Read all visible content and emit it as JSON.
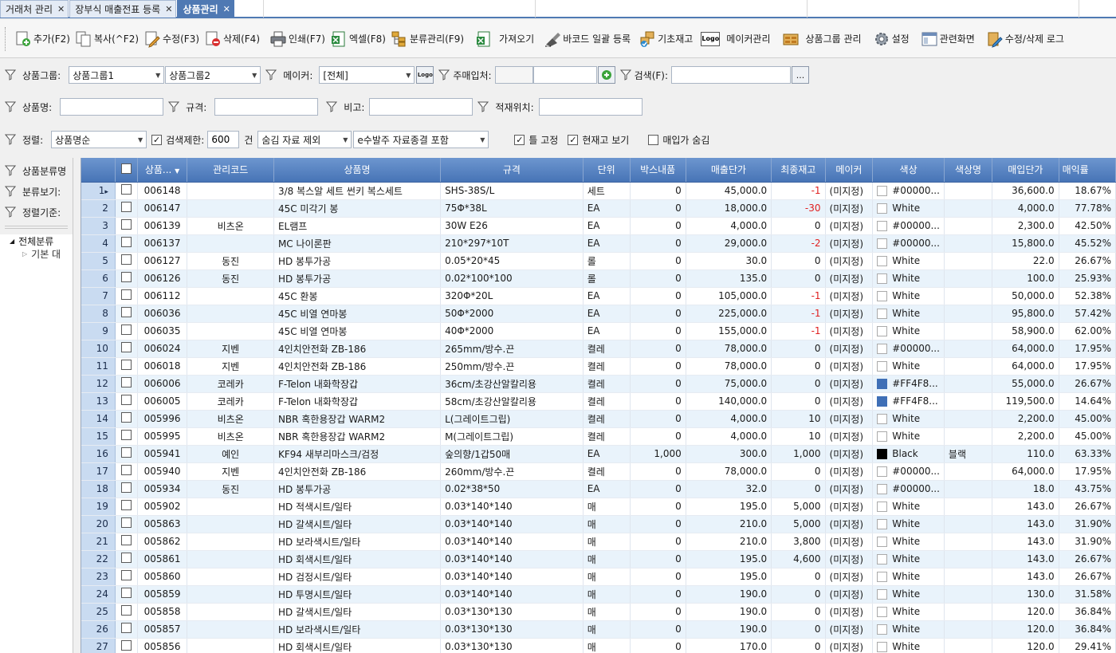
{
  "tabs": [
    {
      "label": "거래처 관리"
    },
    {
      "label": "장부식 매출전표 등록"
    },
    {
      "label": "상품관리"
    }
  ],
  "toolbar": {
    "add": "추가(F2)",
    "copy": "복사(^F2)",
    "edit": "수정(F3)",
    "delete": "삭제(F4)",
    "print": "인쇄(F7)",
    "excel": "엑셀(F8)",
    "category": "분류관리(F9)",
    "import": "가져오기",
    "barcode": "바코드 일괄 등록",
    "base_stock": "기초재고",
    "logo_badge": "Logo",
    "maker": "메이커관리",
    "product_group": "상품그룹 관리",
    "settings": "설정",
    "related": "관련화면",
    "log": "수정/삭제 로그"
  },
  "filters": {
    "group_label": "상품그룹:",
    "group1": "상품그룹1",
    "group2": "상품그룹2",
    "maker_label": "메이커:",
    "maker_value": "[전체]",
    "maker_logo": "Logo",
    "supplier_label": "주매입처:",
    "search_label": "검색(F):",
    "more": "...",
    "name_label": "상품명:",
    "spec_label": "규격:",
    "note_label": "비고:",
    "location_label": "적재위치:",
    "sort_label": "정렬:",
    "sort_value": "상품명순",
    "limit_label": "검색제한:",
    "limit_value": "600",
    "limit_unit": "건",
    "hidden_option": "숨김 자료 제외",
    "order_option": "e수발주 자료종결 포함",
    "fix_frame": "틀 고정",
    "show_stock": "현재고 보기",
    "hide_cost": "매입가 숨김"
  },
  "left_panel": {
    "category_view": "상품분류명",
    "browse": "분류보기:",
    "sort_basis": "정렬기준:",
    "tree_root": "전체분류",
    "tree_child": "기본 대"
  },
  "grid": {
    "columns": [
      "상품...",
      "관리코드",
      "상품명",
      "규격",
      "단위",
      "박스내품",
      "매출단가",
      "최종재고",
      "메이커",
      "색상",
      "색상명",
      "매입단가",
      "매익률"
    ],
    "rows": [
      {
        "n": "1",
        "code": "006148",
        "mgmt": "",
        "name": "3/8 복스알 세트 썬키 복스세트",
        "spec": "SHS-38S/L",
        "unit": "세트",
        "box": "0",
        "price": "45,000.0",
        "stock": "-1",
        "maker": "(미지정)",
        "color": "#00000...",
        "colorname": "",
        "cost": "36,600.0",
        "margin": "18.67%",
        "swatch": "#ffffff",
        "neg": true
      },
      {
        "n": "2",
        "code": "006147",
        "mgmt": "",
        "name": "45C 미각기 봉",
        "spec": "75Φ*38L",
        "unit": "EA",
        "box": "0",
        "price": "18,000.0",
        "stock": "-30",
        "maker": "(미지정)",
        "color": "White",
        "colorname": "",
        "cost": "4,000.0",
        "margin": "77.78%",
        "swatch": "#ffffff",
        "neg": true
      },
      {
        "n": "3",
        "code": "006139",
        "mgmt": "비츠온",
        "name": "EL램프",
        "spec": "30W E26",
        "unit": "EA",
        "box": "0",
        "price": "4,000.0",
        "stock": "0",
        "maker": "(미지정)",
        "color": "#00000...",
        "colorname": "",
        "cost": "2,300.0",
        "margin": "42.50%",
        "swatch": "#ffffff",
        "neg": false
      },
      {
        "n": "4",
        "code": "006137",
        "mgmt": "",
        "name": "MC 나이론판",
        "spec": "210*297*10T",
        "unit": "EA",
        "box": "0",
        "price": "29,000.0",
        "stock": "-2",
        "maker": "(미지정)",
        "color": "#00000...",
        "colorname": "",
        "cost": "15,800.0",
        "margin": "45.52%",
        "swatch": "#ffffff",
        "neg": true
      },
      {
        "n": "5",
        "code": "006127",
        "mgmt": "동진",
        "name": "HD 봉투가공",
        "spec": "0.05*20*45",
        "unit": "롤",
        "box": "0",
        "price": "30.0",
        "stock": "0",
        "maker": "(미지정)",
        "color": "White",
        "colorname": "",
        "cost": "22.0",
        "margin": "26.67%",
        "swatch": "#ffffff",
        "neg": false
      },
      {
        "n": "6",
        "code": "006126",
        "mgmt": "동진",
        "name": "HD 봉투가공",
        "spec": "0.02*100*100",
        "unit": "롤",
        "box": "0",
        "price": "135.0",
        "stock": "0",
        "maker": "(미지정)",
        "color": "White",
        "colorname": "",
        "cost": "100.0",
        "margin": "25.93%",
        "swatch": "#ffffff",
        "neg": false
      },
      {
        "n": "7",
        "code": "006112",
        "mgmt": "",
        "name": "45C 환봉",
        "spec": "320Φ*20L",
        "unit": "EA",
        "box": "0",
        "price": "105,000.0",
        "stock": "-1",
        "maker": "(미지정)",
        "color": "White",
        "colorname": "",
        "cost": "50,000.0",
        "margin": "52.38%",
        "swatch": "#ffffff",
        "neg": true
      },
      {
        "n": "8",
        "code": "006036",
        "mgmt": "",
        "name": "45C 비열 연마봉",
        "spec": "50Φ*2000",
        "unit": "EA",
        "box": "0",
        "price": "225,000.0",
        "stock": "-1",
        "maker": "(미지정)",
        "color": "White",
        "colorname": "",
        "cost": "95,800.0",
        "margin": "57.42%",
        "swatch": "#ffffff",
        "neg": true
      },
      {
        "n": "9",
        "code": "006035",
        "mgmt": "",
        "name": "45C 비열 연마봉",
        "spec": "40Φ*2000",
        "unit": "EA",
        "box": "0",
        "price": "155,000.0",
        "stock": "-1",
        "maker": "(미지정)",
        "color": "White",
        "colorname": "",
        "cost": "58,900.0",
        "margin": "62.00%",
        "swatch": "#ffffff",
        "neg": true
      },
      {
        "n": "10",
        "code": "006024",
        "mgmt": "지벤",
        "name": "4인치안전화 ZB-186",
        "spec": "265mm/방수.끈",
        "unit": "켤레",
        "box": "0",
        "price": "78,000.0",
        "stock": "0",
        "maker": "(미지정)",
        "color": "#00000...",
        "colorname": "",
        "cost": "64,000.0",
        "margin": "17.95%",
        "swatch": "#ffffff",
        "neg": false
      },
      {
        "n": "11",
        "code": "006018",
        "mgmt": "지벤",
        "name": "4인치안전화 ZB-186",
        "spec": "250mm/방수.끈",
        "unit": "켤레",
        "box": "0",
        "price": "78,000.0",
        "stock": "0",
        "maker": "(미지정)",
        "color": "White",
        "colorname": "",
        "cost": "64,000.0",
        "margin": "17.95%",
        "swatch": "#ffffff",
        "neg": false
      },
      {
        "n": "12",
        "code": "006006",
        "mgmt": "코레카",
        "name": "F-Telon 내화학장갑",
        "spec": "36cm/초강산알칼리용",
        "unit": "켤레",
        "box": "0",
        "price": "75,000.0",
        "stock": "0",
        "maker": "(미지정)",
        "color": "#FF4F8...",
        "colorname": "",
        "cost": "55,000.0",
        "margin": "26.67%",
        "swatch": "#3f6fb6",
        "neg": false
      },
      {
        "n": "13",
        "code": "006005",
        "mgmt": "코레카",
        "name": "F-Telon 내화학장갑",
        "spec": "58cm/초강산알칼리용",
        "unit": "켤레",
        "box": "0",
        "price": "140,000.0",
        "stock": "0",
        "maker": "(미지정)",
        "color": "#FF4F8...",
        "colorname": "",
        "cost": "119,500.0",
        "margin": "14.64%",
        "swatch": "#3f6fb6",
        "neg": false
      },
      {
        "n": "14",
        "code": "005996",
        "mgmt": "비츠온",
        "name": "NBR 혹한용장갑 WARM2",
        "spec": "L(그레이트그립)",
        "unit": "켤레",
        "box": "0",
        "price": "4,000.0",
        "stock": "10",
        "maker": "(미지정)",
        "color": "White",
        "colorname": "",
        "cost": "2,200.0",
        "margin": "45.00%",
        "swatch": "#ffffff",
        "neg": false
      },
      {
        "n": "15",
        "code": "005995",
        "mgmt": "비츠온",
        "name": "NBR 혹한용장갑 WARM2",
        "spec": "M(그레이트그립)",
        "unit": "켤레",
        "box": "0",
        "price": "4,000.0",
        "stock": "10",
        "maker": "(미지정)",
        "color": "White",
        "colorname": "",
        "cost": "2,200.0",
        "margin": "45.00%",
        "swatch": "#ffffff",
        "neg": false
      },
      {
        "n": "16",
        "code": "005941",
        "mgmt": "예인",
        "name": "KF94 새부리마스크/검정",
        "spec": "숲의향/1갑50매",
        "unit": "EA",
        "box": "1,000",
        "price": "300.0",
        "stock": "1,000",
        "maker": "(미지정)",
        "color": "Black",
        "colorname": "블랙",
        "cost": "110.0",
        "margin": "63.33%",
        "swatch": "#000000",
        "neg": false
      },
      {
        "n": "17",
        "code": "005940",
        "mgmt": "지벤",
        "name": "4인치안전화 ZB-186",
        "spec": "260mm/방수.끈",
        "unit": "켤레",
        "box": "0",
        "price": "78,000.0",
        "stock": "0",
        "maker": "(미지정)",
        "color": "#00000...",
        "colorname": "",
        "cost": "64,000.0",
        "margin": "17.95%",
        "swatch": "#ffffff",
        "neg": false
      },
      {
        "n": "18",
        "code": "005934",
        "mgmt": "동진",
        "name": "HD 봉투가공",
        "spec": "0.02*38*50",
        "unit": "EA",
        "box": "0",
        "price": "32.0",
        "stock": "0",
        "maker": "(미지정)",
        "color": "#00000...",
        "colorname": "",
        "cost": "18.0",
        "margin": "43.75%",
        "swatch": "#ffffff",
        "neg": false
      },
      {
        "n": "19",
        "code": "005902",
        "mgmt": "",
        "name": "HD 적색시트/일타",
        "spec": "0.03*140*140",
        "unit": "매",
        "box": "0",
        "price": "195.0",
        "stock": "5,000",
        "maker": "(미지정)",
        "color": "White",
        "colorname": "",
        "cost": "143.0",
        "margin": "26.67%",
        "swatch": "#ffffff",
        "neg": false
      },
      {
        "n": "20",
        "code": "005863",
        "mgmt": "",
        "name": "HD 갈색시트/일타",
        "spec": "0.03*140*140",
        "unit": "매",
        "box": "0",
        "price": "210.0",
        "stock": "5,000",
        "maker": "(미지정)",
        "color": "White",
        "colorname": "",
        "cost": "143.0",
        "margin": "31.90%",
        "swatch": "#ffffff",
        "neg": false
      },
      {
        "n": "21",
        "code": "005862",
        "mgmt": "",
        "name": "HD 보라색시트/일타",
        "spec": "0.03*140*140",
        "unit": "매",
        "box": "0",
        "price": "210.0",
        "stock": "3,800",
        "maker": "(미지정)",
        "color": "White",
        "colorname": "",
        "cost": "143.0",
        "margin": "31.90%",
        "swatch": "#ffffff",
        "neg": false
      },
      {
        "n": "22",
        "code": "005861",
        "mgmt": "",
        "name": "HD 회색시트/일타",
        "spec": "0.03*140*140",
        "unit": "매",
        "box": "0",
        "price": "195.0",
        "stock": "4,600",
        "maker": "(미지정)",
        "color": "White",
        "colorname": "",
        "cost": "143.0",
        "margin": "26.67%",
        "swatch": "#ffffff",
        "neg": false
      },
      {
        "n": "23",
        "code": "005860",
        "mgmt": "",
        "name": "HD 검정시트/일타",
        "spec": "0.03*140*140",
        "unit": "매",
        "box": "0",
        "price": "195.0",
        "stock": "0",
        "maker": "(미지정)",
        "color": "White",
        "colorname": "",
        "cost": "143.0",
        "margin": "26.67%",
        "swatch": "#ffffff",
        "neg": false
      },
      {
        "n": "24",
        "code": "005859",
        "mgmt": "",
        "name": "HD 투명시트/일타",
        "spec": "0.03*140*140",
        "unit": "매",
        "box": "0",
        "price": "190.0",
        "stock": "0",
        "maker": "(미지정)",
        "color": "White",
        "colorname": "",
        "cost": "130.0",
        "margin": "31.58%",
        "swatch": "#ffffff",
        "neg": false
      },
      {
        "n": "25",
        "code": "005858",
        "mgmt": "",
        "name": "HD 갈색시트/일타",
        "spec": "0.03*130*130",
        "unit": "매",
        "box": "0",
        "price": "190.0",
        "stock": "0",
        "maker": "(미지정)",
        "color": "White",
        "colorname": "",
        "cost": "120.0",
        "margin": "36.84%",
        "swatch": "#ffffff",
        "neg": false
      },
      {
        "n": "26",
        "code": "005857",
        "mgmt": "",
        "name": "HD 보라색시트/일타",
        "spec": "0.03*130*130",
        "unit": "매",
        "box": "0",
        "price": "190.0",
        "stock": "0",
        "maker": "(미지정)",
        "color": "White",
        "colorname": "",
        "cost": "120.0",
        "margin": "36.84%",
        "swatch": "#ffffff",
        "neg": false
      },
      {
        "n": "27",
        "code": "005856",
        "mgmt": "",
        "name": "HD 회색시트/일타",
        "spec": "0.03*130*130",
        "unit": "매",
        "box": "0",
        "price": "170.0",
        "stock": "0",
        "maker": "(미지정)",
        "color": "White",
        "colorname": "",
        "cost": "120.0",
        "margin": "29.41%",
        "swatch": "#ffffff",
        "neg": false
      }
    ]
  },
  "colors": {
    "accent": "#4f79b3",
    "header": "#4774b6",
    "negative": "#e02020",
    "row_alt": "#e9f3fb"
  }
}
